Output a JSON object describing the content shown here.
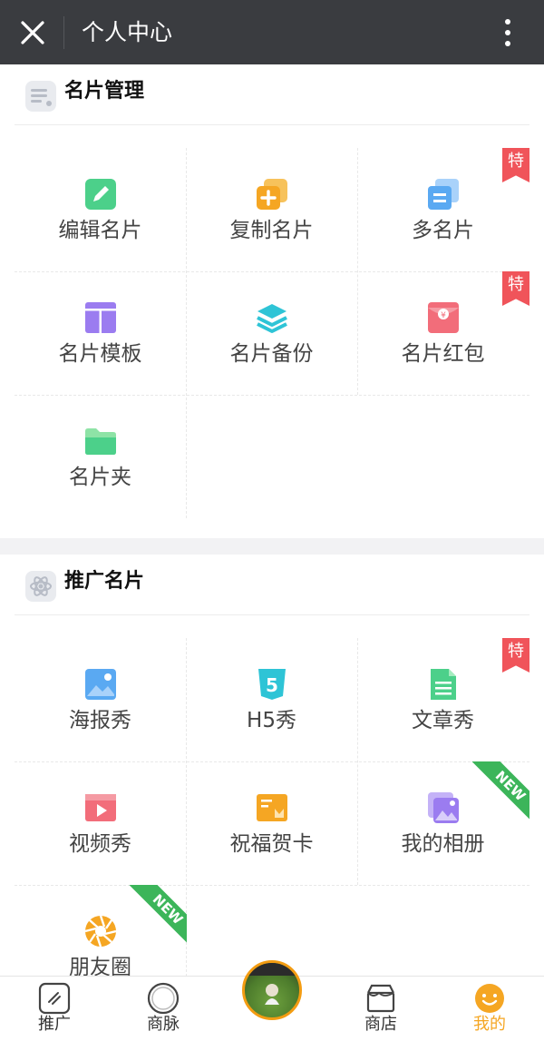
{
  "header": {
    "title": "个人中心",
    "close_icon": "close-icon",
    "more_icon": "more-vertical-icon"
  },
  "sections": [
    {
      "title": "名片管理",
      "icon": "list-card-icon",
      "items": [
        {
          "label": "编辑名片",
          "icon": "edit-icon",
          "color": "#4cd08a"
        },
        {
          "label": "复制名片",
          "icon": "copy-plus-icon",
          "color": "#f5a623"
        },
        {
          "label": "多名片",
          "icon": "multi-card-icon",
          "color": "#5aa9f2",
          "badge": "特"
        },
        {
          "label": "名片模板",
          "icon": "template-icon",
          "color": "#9b7cf0"
        },
        {
          "label": "名片备份",
          "icon": "layers-icon",
          "color": "#2ec4d6"
        },
        {
          "label": "名片红包",
          "icon": "red-envelope-icon",
          "color": "#f26d7a",
          "badge": "特"
        },
        {
          "label": "名片夹",
          "icon": "folder-icon",
          "color": "#4cd08a"
        }
      ]
    },
    {
      "title": "推广名片",
      "icon": "atom-icon",
      "items": [
        {
          "label": "海报秀",
          "icon": "image-icon",
          "color": "#5aa9f2"
        },
        {
          "label": "H5秀",
          "icon": "html5-icon",
          "color": "#2ec4d6"
        },
        {
          "label": "文章秀",
          "icon": "document-icon",
          "color": "#4cd08a",
          "badge": "特"
        },
        {
          "label": "视频秀",
          "icon": "video-icon",
          "color": "#f26d7a"
        },
        {
          "label": "祝福贺卡",
          "icon": "greeting-card-icon",
          "color": "#f5a623"
        },
        {
          "label": "我的相册",
          "icon": "album-icon",
          "color": "#9b7cf0",
          "badge": "NEW"
        },
        {
          "label": "朋友圈",
          "icon": "aperture-icon",
          "color": "#f5a623",
          "badge": "NEW"
        }
      ]
    }
  ],
  "tabbar": {
    "items": [
      {
        "label": "推广",
        "icon": "promote-icon"
      },
      {
        "label": "商脉",
        "icon": "circle-icon"
      },
      {
        "label": "",
        "icon": "avatar"
      },
      {
        "label": "商店",
        "icon": "shop-icon"
      },
      {
        "label": "我的",
        "icon": "smile-icon",
        "active": true
      }
    ],
    "accent": "#f5a623"
  }
}
